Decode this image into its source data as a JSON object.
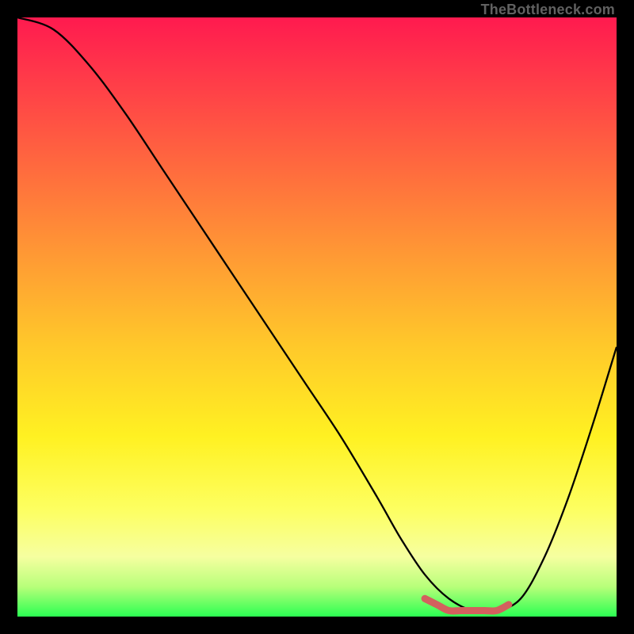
{
  "watermark": "TheBottleneck.com",
  "chart_data": {
    "type": "line",
    "title": "",
    "xlabel": "",
    "ylabel": "",
    "xlim": [
      0,
      100
    ],
    "ylim": [
      0,
      100
    ],
    "series": [
      {
        "name": "bottleneck-curve",
        "x": [
          0,
          6,
          12,
          18,
          24,
          30,
          36,
          42,
          48,
          54,
          60,
          64,
          68,
          72,
          76,
          80,
          84,
          88,
          92,
          96,
          100
        ],
        "values": [
          100,
          98,
          92,
          84,
          75,
          66,
          57,
          48,
          39,
          30,
          20,
          13,
          7,
          3,
          1,
          1,
          3,
          10,
          20,
          32,
          45
        ]
      },
      {
        "name": "optimal-range",
        "x": [
          68,
          70,
          72,
          74,
          76,
          78,
          80,
          82
        ],
        "values": [
          3,
          2,
          1,
          1,
          1,
          1,
          1,
          2
        ]
      }
    ],
    "gradient_stops": [
      {
        "pos": 0,
        "color": "#ff1a4f"
      },
      {
        "pos": 10,
        "color": "#ff3a49"
      },
      {
        "pos": 25,
        "color": "#ff6a3e"
      },
      {
        "pos": 40,
        "color": "#ff9a34"
      },
      {
        "pos": 55,
        "color": "#ffc92a"
      },
      {
        "pos": 70,
        "color": "#fff122"
      },
      {
        "pos": 82,
        "color": "#fdff60"
      },
      {
        "pos": 90,
        "color": "#f6ffa0"
      },
      {
        "pos": 95,
        "color": "#b8ff7a"
      },
      {
        "pos": 100,
        "color": "#2bff52"
      }
    ],
    "optimal_marker_color": "#d3605e"
  }
}
